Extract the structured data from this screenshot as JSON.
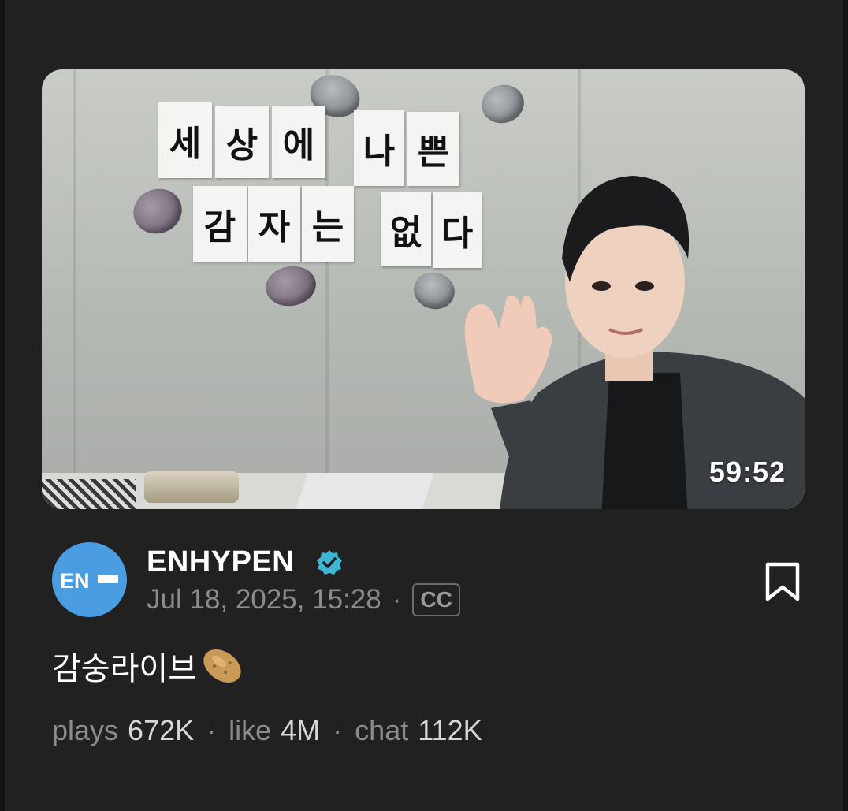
{
  "video": {
    "duration": "59:52",
    "sign_words": [
      "세",
      "상",
      "에",
      "나",
      "쁜",
      "감",
      "자",
      "는",
      "없",
      "다"
    ]
  },
  "channel": {
    "logo_text": "EN",
    "name": "ENHYPEN",
    "date": "Jul 18, 2025, 15:28",
    "separator": "·",
    "cc_label": "CC"
  },
  "post": {
    "title": "감숭라이브"
  },
  "stats": {
    "plays_label": "plays",
    "plays_value": "672K",
    "like_label": "like",
    "like_value": "4M",
    "chat_label": "chat",
    "chat_value": "112K",
    "separator": "·"
  },
  "colors": {
    "background": "#212121",
    "avatar": "#4a9de0",
    "verified": "#3fb5d6"
  },
  "icons": [
    "verified-badge-icon",
    "bookmark-icon",
    "potato-emoji-icon"
  ]
}
